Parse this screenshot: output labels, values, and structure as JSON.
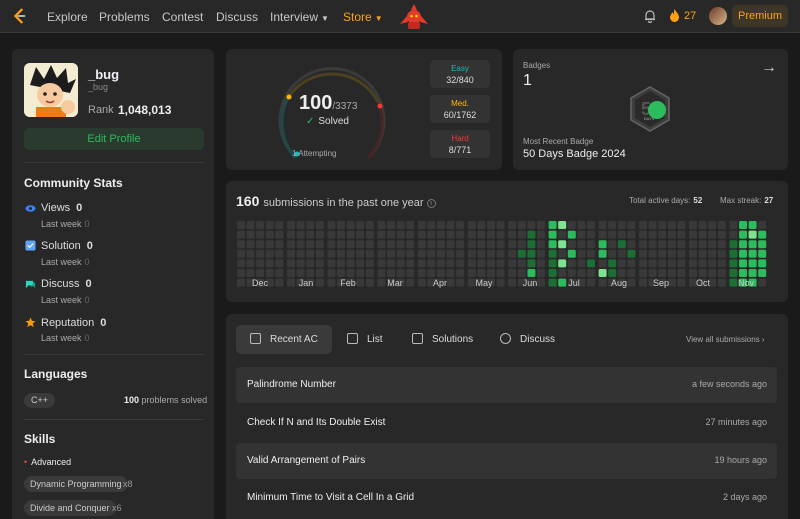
{
  "nav": {
    "links": [
      "Explore",
      "Problems",
      "Contest",
      "Discuss",
      "Interview",
      "Store"
    ],
    "streak": "27",
    "premium": "Premium"
  },
  "profile": {
    "username": "_bug",
    "handle": "_bug",
    "rank_label": "Rank",
    "rank": "1,048,013",
    "edit_label": "Edit Profile"
  },
  "community": {
    "title": "Community Stats",
    "items": [
      {
        "label": "Views",
        "value": "0",
        "sub": "Last week",
        "sub_value": "0",
        "icon": "eye-icon",
        "color": "#3b82f6"
      },
      {
        "label": "Solution",
        "value": "0",
        "sub": "Last week",
        "sub_value": "0",
        "icon": "solution-icon",
        "color": "#60a5fa"
      },
      {
        "label": "Discuss",
        "value": "0",
        "sub": "Last week",
        "sub_value": "0",
        "icon": "discuss-icon",
        "color": "#2dd4bf"
      },
      {
        "label": "Reputation",
        "value": "0",
        "sub": "Last week",
        "sub_value": "0",
        "icon": "star-icon",
        "color": "#f59e0b"
      }
    ]
  },
  "languages": {
    "title": "Languages",
    "items": [
      {
        "name": "C++",
        "count": "100",
        "suffix": "problems solved"
      }
    ]
  },
  "skills": {
    "title": "Skills",
    "level": "Advanced",
    "items": [
      {
        "name": "Dynamic Programming",
        "count": "x8"
      },
      {
        "name": "Divide and Conquer",
        "count": "x6"
      }
    ]
  },
  "progress": {
    "solved": "100",
    "total": "/3373",
    "solved_label": "Solved",
    "attempting": "1 Attempting",
    "solved_fraction": 0.0296,
    "easy": {
      "label": "Easy",
      "value": "32/840",
      "color": "#1cbaba"
    },
    "medium": {
      "label": "Med.",
      "value": "60/1762",
      "color": "#ffb700"
    },
    "hard": {
      "label": "Hard",
      "value": "8/771",
      "color": "#f63737"
    }
  },
  "badges": {
    "title": "Badges",
    "count": "1",
    "recent_label": "Most Recent Badge",
    "recent_name": "50 Days Badge 2024",
    "badge_text": "DAYS"
  },
  "heatmap": {
    "count": "160",
    "label": "submissions in the past one year",
    "active_label": "Total active days:",
    "active_days": "52",
    "streak_label": "Max streak:",
    "max_streak": "27",
    "months": [
      "Dec",
      "Jan",
      "Feb",
      "Mar",
      "Apr",
      "May",
      "Jun",
      "Jul",
      "Aug",
      "Sep",
      "Oct",
      "Nov"
    ]
  },
  "recent": {
    "tabs": [
      "Recent AC",
      "List",
      "Solutions",
      "Discuss"
    ],
    "view_all": "View all submissions",
    "rows": [
      {
        "title": "Palindrome Number",
        "time": "a few seconds ago"
      },
      {
        "title": "Check If N and Its Double Exist",
        "time": "27 minutes ago"
      },
      {
        "title": "Valid Arrangement of Pairs",
        "time": "19 hours ago"
      },
      {
        "title": "Minimum Time to Visit a Cell In a Grid",
        "time": "2 days ago"
      }
    ]
  }
}
